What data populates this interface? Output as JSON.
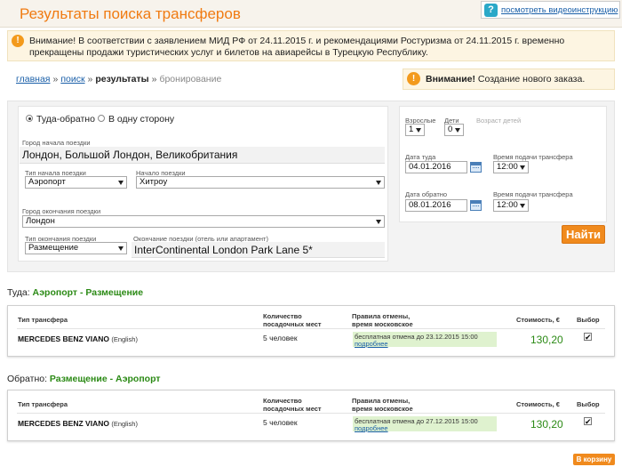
{
  "header": {
    "title": "Результаты поиска трансферов",
    "video_link": "посмотреть видеоинструкцию",
    "video_icon": "?"
  },
  "alert": {
    "text": "Внимание! В соответствии с заявлением МИД РФ от 24.11.2015 г. и рекомендациями Ростуризма от 24.11.2015 г. временно прекращены продажи туристических услуг и билетов на авиарейсы в Турецкую Республику."
  },
  "breadcrumb": {
    "items": [
      "главная",
      "поиск",
      "результаты",
      "бронирование"
    ],
    "sep": "»"
  },
  "warning": {
    "bold": "Внимание!",
    "text": " Создание нового заказа."
  },
  "search": {
    "trip_round": "Туда-обратно",
    "trip_oneway": "В одну сторону",
    "from_city_label": "Город начала поездки",
    "from_city_value": "Лондон, Большой Лондон, Великобритания",
    "start_type_label": "Тип начала поездки",
    "start_type_value": "Аэропорт",
    "start_place_label": "Начало поездки",
    "start_place_value": "Хитроу",
    "to_city_label": "Город окончания поездки",
    "to_city_value": "Лондон",
    "end_type_label": "Тип окончания поездки",
    "end_type_value": "Размещение",
    "end_place_label": "Окончание поездки (отель или апартамент)",
    "end_place_value": "InterContinental London Park Lane 5*",
    "adults_label": "Взрослые",
    "adults_value": "1",
    "children_label": "Дети",
    "children_value": "0",
    "children_age_label": "Возраст детей",
    "date_there_label": "Дата туда",
    "date_there_value": "04.01.2016",
    "time_there_label": "Время подачи трансфера",
    "time_there_value": "12:00",
    "date_back_label": "Дата обратно",
    "date_back_value": "08.01.2016",
    "time_back_label": "Время подачи трансфера",
    "time_back_value": "12:00",
    "find_button": "Найти"
  },
  "results": [
    {
      "direction_label": "Туда: ",
      "route": "Аэропорт - Размещение",
      "headers": {
        "type": "Тип трансфера",
        "seats": [
          "Количество",
          "посадочных мест"
        ],
        "cancel": [
          "Правила отмены,",
          "время московское"
        ],
        "cost": "Стоимость, €",
        "select": "Выбор"
      },
      "car": "MERCEDES BENZ VIANO",
      "lang": "(English)",
      "people": "5 человек",
      "cancel_text": "бесплатная отмена до 23.12.2015 15:00",
      "more": "подробнее",
      "price": "130,20",
      "selected": "✔"
    },
    {
      "direction_label": "Обратно: ",
      "route": "Размещение - Аэропорт",
      "headers": {
        "type": "Тип трансфера",
        "seats": [
          "Количество",
          "посадочных мест"
        ],
        "cancel": [
          "Правила отмены,",
          "время московское"
        ],
        "cost": "Стоимость, €",
        "select": "Выбор"
      },
      "car": "MERCEDES BENZ VIANO",
      "lang": "(English)",
      "people": "5 человек",
      "cancel_text": "бесплатная отмена до 27.12.2015 15:00",
      "more": "подробнее",
      "price": "130,20",
      "selected": "✔"
    }
  ],
  "cart_button": "В корзину",
  "colors": {
    "accent_orange": "#f07b12",
    "route_green": "#2b8a15",
    "link_blue": "#1a5fa8",
    "alert_bg": "#fdf5e2"
  }
}
